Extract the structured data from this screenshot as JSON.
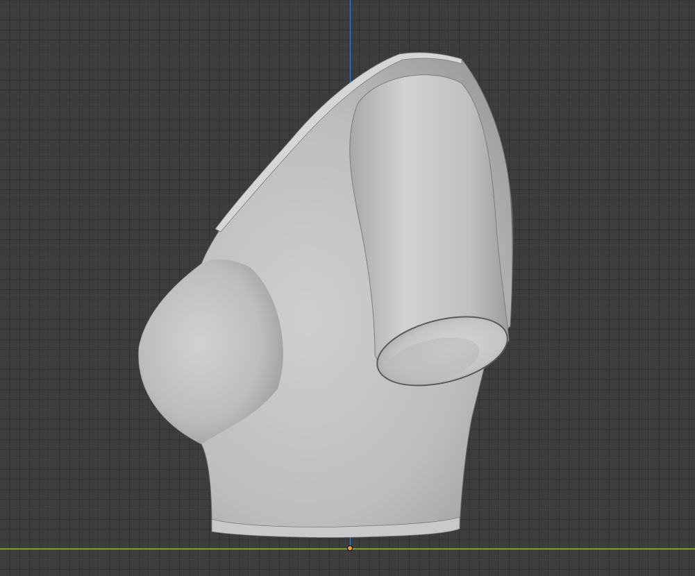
{
  "viewport": {
    "background": "#3d3d3d",
    "grid_minor_color": "#353535",
    "grid_major_color": "#4a4a4a",
    "axis_z_color": "#2d7fd6",
    "axis_y_color": "#7aa32c",
    "origin_color": "#f0a030"
  },
  "object": {
    "kind": "garment-mesh",
    "shading": "solid",
    "base_color": "#bdbdbd"
  }
}
